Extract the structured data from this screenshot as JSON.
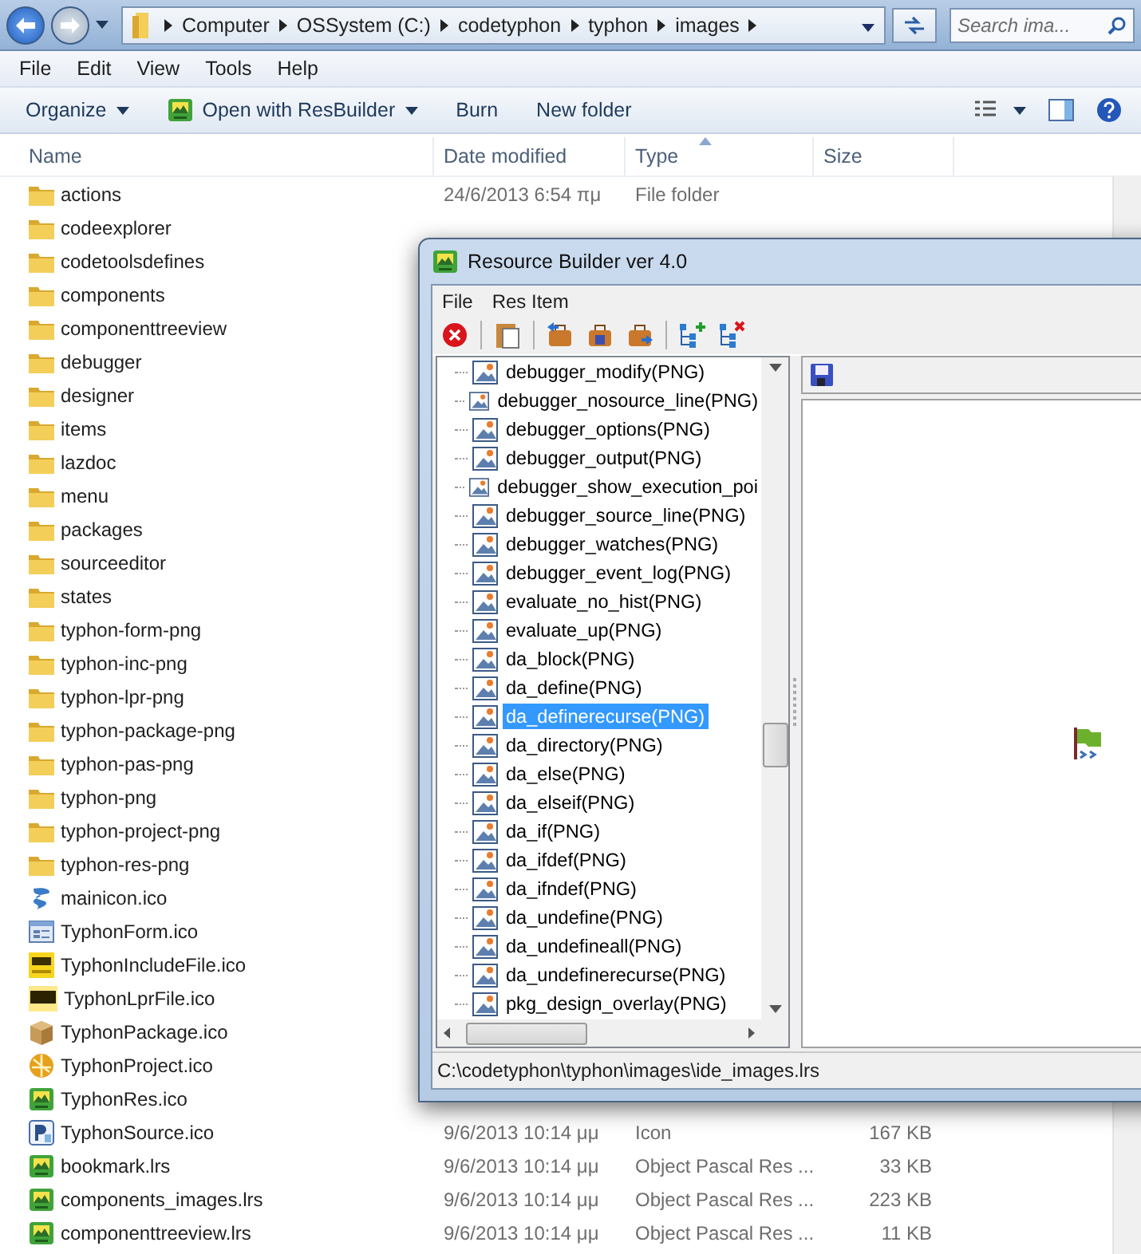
{
  "explorer": {
    "breadcrumb": [
      "Computer",
      "OSSystem (C:)",
      "codetyphon",
      "typhon",
      "images"
    ],
    "search": {
      "placeholder": "Search ima..."
    },
    "menu": [
      "File",
      "Edit",
      "View",
      "Tools",
      "Help"
    ],
    "commands": [
      {
        "label": "Organize",
        "dropdown": true,
        "icon": false
      },
      {
        "label": "Open with ResBuilder",
        "dropdown": true,
        "icon": true
      },
      {
        "label": "Burn",
        "dropdown": false,
        "icon": false
      },
      {
        "label": "New folder",
        "dropdown": false,
        "icon": false
      }
    ],
    "columns": [
      {
        "label": "Name",
        "sorted": false
      },
      {
        "label": "Date modified",
        "sorted": false
      },
      {
        "label": "Type",
        "sorted": true
      },
      {
        "label": "Size",
        "sorted": false
      }
    ],
    "rows": [
      {
        "name": "actions",
        "kind": "folder",
        "date": "24/6/2013 6:54 πμ",
        "type": "File folder"
      },
      {
        "name": "codeexplorer",
        "kind": "folder"
      },
      {
        "name": "codetoolsdefines",
        "kind": "folder"
      },
      {
        "name": "components",
        "kind": "folder"
      },
      {
        "name": "componenttreeview",
        "kind": "folder"
      },
      {
        "name": "debugger",
        "kind": "folder"
      },
      {
        "name": "designer",
        "kind": "folder"
      },
      {
        "name": "items",
        "kind": "folder"
      },
      {
        "name": "lazdoc",
        "kind": "folder"
      },
      {
        "name": "menu",
        "kind": "folder"
      },
      {
        "name": "packages",
        "kind": "folder"
      },
      {
        "name": "sourceeditor",
        "kind": "folder"
      },
      {
        "name": "states",
        "kind": "folder"
      },
      {
        "name": "typhon-form-png",
        "kind": "folder"
      },
      {
        "name": "typhon-inc-png",
        "kind": "folder"
      },
      {
        "name": "typhon-lpr-png",
        "kind": "folder"
      },
      {
        "name": "typhon-package-png",
        "kind": "folder"
      },
      {
        "name": "typhon-pas-png",
        "kind": "folder"
      },
      {
        "name": "typhon-png",
        "kind": "folder"
      },
      {
        "name": "typhon-project-png",
        "kind": "folder"
      },
      {
        "name": "typhon-res-png",
        "kind": "folder"
      },
      {
        "name": "mainicon.ico",
        "kind": "swirl"
      },
      {
        "name": "TyphonForm.ico",
        "kind": "form"
      },
      {
        "name": "TyphonIncludeFile.ico",
        "kind": "include"
      },
      {
        "name": "TyphonLprFile.ico",
        "kind": "lpr"
      },
      {
        "name": "TyphonPackage.ico",
        "kind": "package"
      },
      {
        "name": "TyphonProject.ico",
        "kind": "project"
      },
      {
        "name": "TyphonRes.ico",
        "kind": "res"
      },
      {
        "name": "TyphonSource.ico",
        "kind": "source",
        "date": "9/6/2013 10:14 μμ",
        "type": "Icon",
        "size": "167 KB"
      },
      {
        "name": "bookmark.lrs",
        "kind": "res",
        "date": "9/6/2013 10:14 μμ",
        "type": "Object Pascal Res ...",
        "size": "33 KB"
      },
      {
        "name": "components_images.lrs",
        "kind": "res",
        "date": "9/6/2013 10:14 μμ",
        "type": "Object Pascal Res ...",
        "size": "223 KB"
      },
      {
        "name": "componenttreeview.lrs",
        "kind": "res",
        "date": "9/6/2013 10:14 μμ",
        "type": "Object Pascal Res ...",
        "size": "11 KB"
      }
    ]
  },
  "dialog": {
    "title": "Resource Builder ver 4.0",
    "menu": [
      "File",
      "Res Item"
    ],
    "items": [
      {
        "label": "debugger_modify(PNG)",
        "selected": false
      },
      {
        "label": "debugger_nosource_line(PNG)",
        "selected": false
      },
      {
        "label": "debugger_options(PNG)",
        "selected": false
      },
      {
        "label": "debugger_output(PNG)",
        "selected": false
      },
      {
        "label": "debugger_show_execution_poi",
        "selected": false
      },
      {
        "label": "debugger_source_line(PNG)",
        "selected": false
      },
      {
        "label": "debugger_watches(PNG)",
        "selected": false
      },
      {
        "label": "debugger_event_log(PNG)",
        "selected": false
      },
      {
        "label": "evaluate_no_hist(PNG)",
        "selected": false
      },
      {
        "label": "evaluate_up(PNG)",
        "selected": false
      },
      {
        "label": "da_block(PNG)",
        "selected": false
      },
      {
        "label": "da_define(PNG)",
        "selected": false
      },
      {
        "label": "da_definerecurse(PNG)",
        "selected": true
      },
      {
        "label": "da_directory(PNG)",
        "selected": false
      },
      {
        "label": "da_else(PNG)",
        "selected": false
      },
      {
        "label": "da_elseif(PNG)",
        "selected": false
      },
      {
        "label": "da_if(PNG)",
        "selected": false
      },
      {
        "label": "da_ifdef(PNG)",
        "selected": false
      },
      {
        "label": "da_ifndef(PNG)",
        "selected": false
      },
      {
        "label": "da_undefine(PNG)",
        "selected": false
      },
      {
        "label": "da_undefineall(PNG)",
        "selected": false
      },
      {
        "label": "da_undefinerecurse(PNG)",
        "selected": false
      },
      {
        "label": "pkg_design_overlay(PNG)",
        "selected": false
      }
    ],
    "status": "C:\\codetyphon\\typhon\\images\\ide_images.lrs"
  }
}
